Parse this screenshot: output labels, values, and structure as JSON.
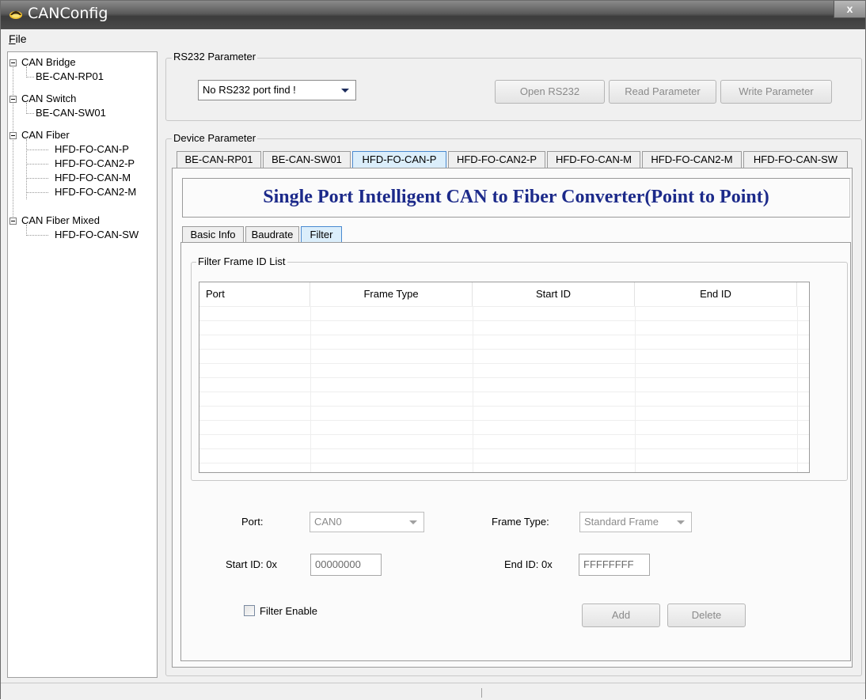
{
  "window": {
    "title": "CANConfig",
    "close_label": "x"
  },
  "menu": {
    "file_accel": "F",
    "file_rest": "ile"
  },
  "tree": {
    "groups": [
      {
        "label": "CAN Bridge",
        "children": [
          "BE-CAN-RP01"
        ]
      },
      {
        "label": "CAN Switch",
        "children": [
          "BE-CAN-SW01"
        ]
      },
      {
        "label": "CAN Fiber",
        "children": [
          "HFD-FO-CAN-P",
          "HFD-FO-CAN2-P",
          "HFD-FO-CAN-M",
          "HFD-FO-CAN2-M"
        ]
      },
      {
        "label": "CAN Fiber Mixed",
        "children": [
          "HFD-FO-CAN-SW"
        ]
      }
    ],
    "selected": "HFD-FO-CAN-P"
  },
  "rs232": {
    "group_label": "RS232 Parameter",
    "port_value": "No RS232 port find !",
    "open_label": "Open RS232",
    "read_label": "Read Parameter",
    "write_label": "Write Parameter"
  },
  "device": {
    "group_label": "Device Parameter",
    "tabs": [
      "BE-CAN-RP01",
      "BE-CAN-SW01",
      "HFD-FO-CAN-P",
      "HFD-FO-CAN2-P",
      "HFD-FO-CAN-M",
      "HFD-FO-CAN2-M",
      "HFD-FO-CAN-SW"
    ],
    "active_tab": "HFD-FO-CAN-P",
    "title": "Single Port Intelligent CAN to Fiber Converter(Point to Point)"
  },
  "sub_tabs": {
    "items": [
      "Basic Info",
      "Baudrate",
      "Filter"
    ],
    "active": "Filter"
  },
  "filter": {
    "list_label": "Filter Frame ID List",
    "columns": [
      "Port",
      "Frame Type",
      "Start ID",
      "End ID"
    ],
    "port_label": "Port:",
    "port_value": "CAN0",
    "frame_type_label": "Frame Type:",
    "frame_type_value": "Standard Frame",
    "start_id_label": "Start ID: 0x",
    "start_id_value": "00000000",
    "end_id_label": "End ID: 0x",
    "end_id_value": "FFFFFFFF",
    "enable_label": "Filter Enable",
    "enable_checked": false,
    "add_label": "Add",
    "delete_label": "Delete"
  },
  "colors": {
    "title_text": "#1c2a8a",
    "active_tab": "#dbeefb",
    "active_tab_border": "#4a8ad0"
  }
}
